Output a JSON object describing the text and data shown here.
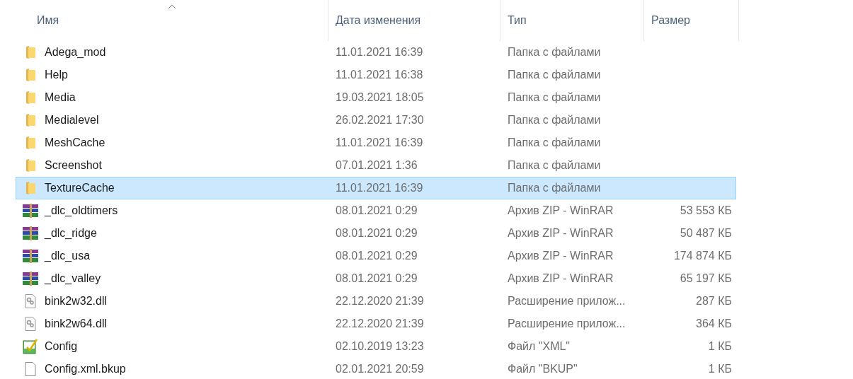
{
  "columns": [
    {
      "label": "Имя",
      "sorted": true
    },
    {
      "label": "Дата изменения",
      "sorted": false
    },
    {
      "label": "Тип",
      "sorted": false
    },
    {
      "label": "Размер",
      "sorted": false
    }
  ],
  "rows": [
    {
      "kind": "folder",
      "name": "Adega_mod",
      "date": "11.01.2021 16:39",
      "type": "Папка с файлами",
      "selected": false
    },
    {
      "kind": "folder",
      "name": "Help",
      "date": "11.01.2021 16:38",
      "type": "Папка с файлами",
      "selected": false
    },
    {
      "kind": "folder",
      "name": "Media",
      "date": "19.03.2021 18:05",
      "type": "Папка с файлами",
      "selected": false
    },
    {
      "kind": "folder",
      "name": "Medialevel",
      "date": "26.02.2021 17:30",
      "type": "Папка с файлами",
      "selected": false
    },
    {
      "kind": "folder",
      "name": "MeshCache",
      "date": "11.01.2021 16:39",
      "type": "Папка с файлами",
      "selected": false
    },
    {
      "kind": "folder",
      "name": "Screenshot",
      "date": "07.01.2021 1:36",
      "type": "Папка с файлами",
      "selected": false
    },
    {
      "kind": "folder",
      "name": "TextureCache",
      "date": "11.01.2021 16:39",
      "type": "Папка с файлами",
      "selected": true
    },
    {
      "kind": "archive",
      "name": "_dlc_oldtimers",
      "date": "08.01.2021 0:29",
      "type": "Архив ZIP - WinRAR",
      "size": "53 553 КБ",
      "selected": false
    },
    {
      "kind": "archive",
      "name": "_dlc_ridge",
      "date": "08.01.2021 0:29",
      "type": "Архив ZIP - WinRAR",
      "size": "50 487 КБ",
      "selected": false
    },
    {
      "kind": "archive",
      "name": "_dlc_usa",
      "date": "08.01.2021 0:29",
      "type": "Архив ZIP - WinRAR",
      "size": "174 874 КБ",
      "selected": false
    },
    {
      "kind": "archive",
      "name": "_dlc_valley",
      "date": "08.01.2021 0:29",
      "type": "Архив ZIP - WinRAR",
      "size": "65 197 КБ",
      "selected": false
    },
    {
      "kind": "dll",
      "name": "bink2w32.dll",
      "date": "22.12.2020 21:39",
      "type": "Расширение прилож...",
      "size": "287 КБ",
      "selected": false
    },
    {
      "kind": "dll",
      "name": "bink2w64.dll",
      "date": "22.12.2020 21:39",
      "type": "Расширение прилож...",
      "size": "364 КБ",
      "selected": false
    },
    {
      "kind": "xml",
      "name": "Config",
      "date": "02.10.2019 13:23",
      "type": "Файл \"XML\"",
      "size": "1 КБ",
      "selected": false
    },
    {
      "kind": "file",
      "name": "Config.xml.bkup",
      "date": "02.01.2021 20:59",
      "type": "Файл \"BKUP\"",
      "size": "1 КБ",
      "selected": false
    }
  ]
}
